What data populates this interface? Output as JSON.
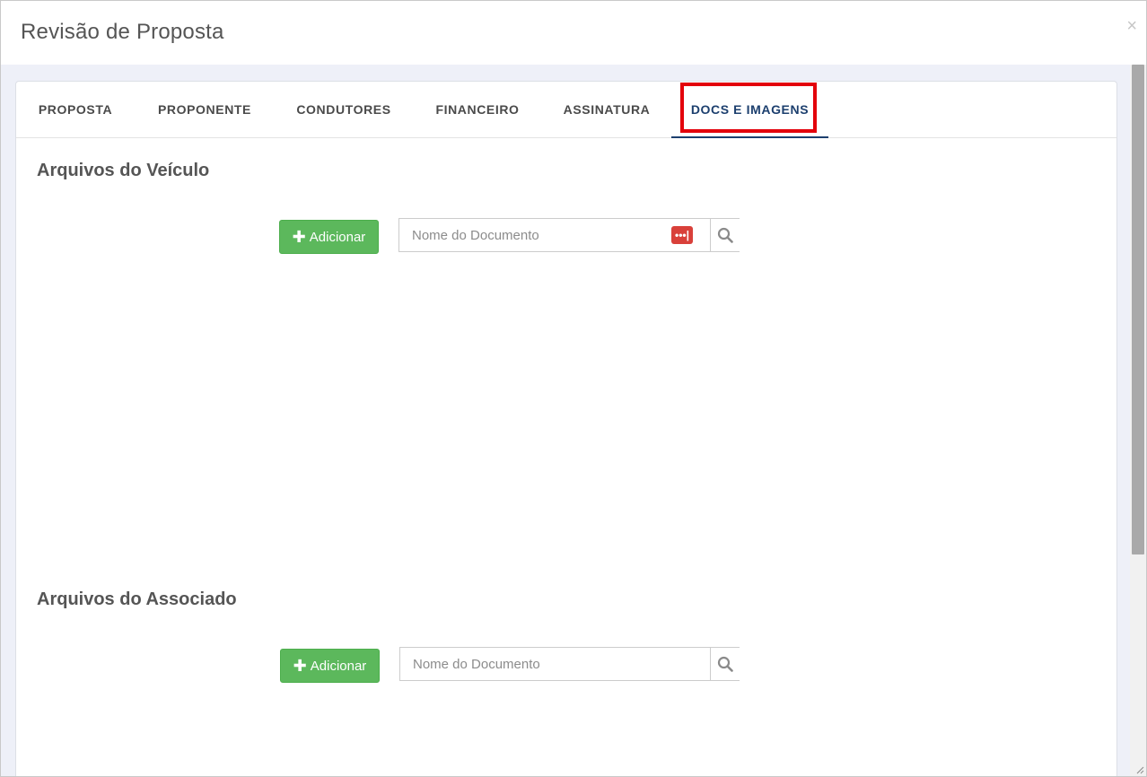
{
  "modal": {
    "title": "Revisão de Proposta",
    "close_label": "×"
  },
  "tabs": [
    {
      "label": "PROPOSTA"
    },
    {
      "label": "PROPONENTE"
    },
    {
      "label": "CONDUTORES"
    },
    {
      "label": "FINANCEIRO"
    },
    {
      "label": "ASSINATURA"
    },
    {
      "label": "DOCS E IMAGENS",
      "active": true
    }
  ],
  "sections": {
    "vehicle": {
      "title": "Arquivos do Veículo",
      "add_label": "Adicionar",
      "input_placeholder": "Nome do Documento",
      "input_value": "",
      "password_icon_label": "•••|"
    },
    "associate": {
      "title": "Arquivos do Associado",
      "add_label": "Adicionar",
      "input_placeholder": "Nome do Documento",
      "input_value": ""
    }
  },
  "colors": {
    "accent_tab": "#1c3f6e",
    "highlight_border": "#e3000b",
    "add_button": "#5cb85c",
    "password_icon": "#d9403a"
  },
  "icons": {
    "close": "close-icon",
    "plus": "plus-icon",
    "search": "search-icon",
    "password_manager": "password-manager-icon",
    "resize": "resize-grip-icon"
  }
}
